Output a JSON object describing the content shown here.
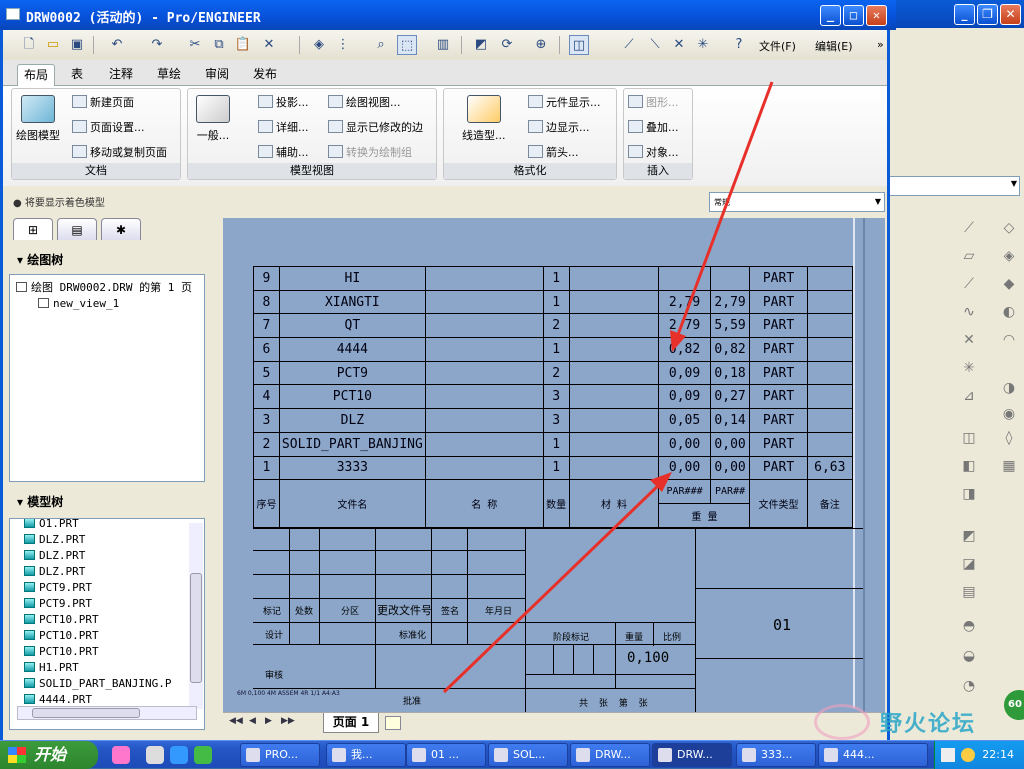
{
  "window": {
    "title": "DRW0002 (活动的) - Pro/ENGINEER"
  },
  "toolbar": {
    "menu_file": "文件(F)",
    "menu_edit": "编辑(E)",
    "overflow": "»"
  },
  "ribbon_tabs": [
    "布局",
    "表",
    "注释",
    "草绘",
    "审阅",
    "发布"
  ],
  "ribbon": {
    "doc_group": {
      "label": "文档",
      "big": "绘图模型",
      "items": [
        "新建页面",
        "页面设置...",
        "移动或复制页面"
      ]
    },
    "model_view_group": {
      "label": "模型视图",
      "big": "一般...",
      "col1": [
        "投影...",
        "详细...",
        "辅助..."
      ],
      "col2": [
        "绘图视图...",
        "显示已修改的边",
        "转换为绘制组"
      ]
    },
    "format_group": {
      "label": "格式化",
      "big": "线造型...",
      "items": [
        "元件显示...",
        "边显示...",
        "箭头..."
      ]
    },
    "insert_group": {
      "label": "插入",
      "items": [
        "图形...",
        "叠加...",
        "对象..."
      ]
    }
  },
  "status": {
    "message": "将要显示着色模型",
    "filter_value": "常规"
  },
  "left_panel": {
    "drawing_tree_header": "绘图树",
    "drawing_tree_root": "绘图 DRW0002.DRW 的第 1 页",
    "drawing_tree_child": "new_view_1",
    "model_tree_header": "模型树",
    "model_tree_items": [
      "O1.PRT",
      "DLZ.PRT",
      "DLZ.PRT",
      "DLZ.PRT",
      "PCT9.PRT",
      "PCT9.PRT",
      "PCT10.PRT",
      "PCT10.PRT",
      "PCT10.PRT",
      "H1.PRT",
      "SOLID_PART_BANJING.P",
      "4444.PRT"
    ]
  },
  "bom": {
    "rows": [
      [
        "9",
        "HI",
        "",
        "1",
        "",
        "",
        "",
        "PART",
        ""
      ],
      [
        "8",
        "XIANGTI",
        "",
        "1",
        "",
        "2,79",
        "2,79",
        "PART",
        ""
      ],
      [
        "7",
        "QT",
        "",
        "2",
        "",
        "2,79",
        "5,59",
        "PART",
        ""
      ],
      [
        "6",
        "4444",
        "",
        "1",
        "",
        "0,82",
        "0,82",
        "PART",
        ""
      ],
      [
        "5",
        "PCT9",
        "",
        "2",
        "",
        "0,09",
        "0,18",
        "PART",
        ""
      ],
      [
        "4",
        "PCT10",
        "",
        "3",
        "",
        "0,09",
        "0,27",
        "PART",
        ""
      ],
      [
        "3",
        "DLZ",
        "",
        "3",
        "",
        "0,05",
        "0,14",
        "PART",
        ""
      ],
      [
        "2",
        "SOLID_PART_BANJING",
        "",
        "1",
        "",
        "0,00",
        "0,00",
        "PART",
        ""
      ],
      [
        "1",
        "3333",
        "",
        "1",
        "",
        "0,00",
        "0,00",
        "PART",
        "6,63"
      ]
    ],
    "header": {
      "seq": "序号",
      "file_name": "文件名",
      "name": "名 称",
      "qty": "数量",
      "material": "材 料",
      "param1": "PAR###",
      "param2": "PAR##",
      "weight": "重 量",
      "file_type": "文件类型",
      "remark": "备注"
    }
  },
  "title_block": {
    "labels": [
      "标记",
      "处数",
      "分区",
      "更改文件号",
      "签名",
      "年月日"
    ],
    "design": "设计",
    "standard": "标准化",
    "review": "审核",
    "approve": "批准",
    "stage_mark": "阶段标记",
    "weight": "重量",
    "scale": "比例",
    "scale_value": "0,100",
    "part_no": "01",
    "sheets": "共 张 第 张",
    "footer": "6M 0,100 4M ASSEM 4R 1/1 A4:A3"
  },
  "sheet_tabs": {
    "page": "页面 1"
  },
  "taskbar": {
    "start": "开始",
    "tasks": [
      "PRO...",
      "我...",
      "01 ...",
      "SOL...",
      "DRW...",
      "DRW...",
      "333...",
      "444..."
    ],
    "clock": "22:14"
  },
  "watermark": "野火论坛",
  "badge": "60"
}
